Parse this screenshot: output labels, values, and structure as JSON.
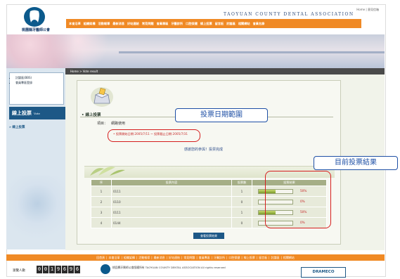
{
  "header": {
    "logo_text": "桃園縣牙醫師公會",
    "top_links": "Home | 意見信箱",
    "nav": [
      "本會沿革",
      "組織架構",
      "活動報導",
      "最新消息",
      "好站連結",
      "常見問題",
      "會員專區",
      "牙醫診所",
      "口腔保健",
      "線上投票",
      "留言板",
      "討論區",
      "相關網站",
      "會員名錄"
    ],
    "banner_text": "TAOYUAN COUNTY DENTAL ASSOCIATION"
  },
  "sidebar": {
    "links": [
      "討論區(BBS)",
      "會員專區登錄"
    ],
    "section_title": "線上投票",
    "section_title_en": "Vote",
    "sub_item": "線上投票"
  },
  "breadcrumb": "Home > Vote result",
  "vote": {
    "title": "線上投票",
    "item_label": "項目：",
    "item_value": "網路使用",
    "date_range": "投票開始日期:2005/7/11 ~ 投票截止日期:2005/7/31",
    "done_message": "感謝您的參與！投票完成",
    "result_button": "查看投票結果"
  },
  "results_table": {
    "headers": [
      "序",
      "投票內容",
      "投票數",
      "投票結果"
    ],
    "rows": [
      {
        "no": "1",
        "content": "0111",
        "votes": "1",
        "pct": 0.5,
        "pct_label": "50%"
      },
      {
        "no": "2",
        "content": "0110",
        "votes": "0",
        "pct": 0,
        "pct_label": "0%"
      },
      {
        "no": "3",
        "content": "0111",
        "votes": "1",
        "pct": 0.5,
        "pct_label": "50%"
      },
      {
        "no": "4",
        "content": "0144",
        "votes": "0",
        "pct": 0,
        "pct_label": "0%"
      }
    ]
  },
  "footer": {
    "nav": [
      "回首頁",
      "本會沿革",
      "組織架構",
      "活動報導",
      "最新消息",
      "好站連結",
      "常見問題",
      "會員專區",
      "牙醫診所",
      "口腔保健",
      "線上投票",
      "留言板",
      "討論區",
      "相關網站"
    ],
    "counter_label": "瀏覽人數",
    "counter_digits": [
      "0",
      "0",
      "1",
      "9",
      "6",
      "9",
      "6"
    ],
    "copyright": "桃園縣牙醫師公會版權所有 TAOYUAN COUNTY DENTAL ASSOCIATION All rights reserved",
    "badge": "DRAMECO"
  },
  "annotations": {
    "date_callout": "投票日期範圍",
    "result_callout": "目前投票結果"
  },
  "colors": {
    "nav_orange": "#f08a25",
    "header_blue": "#1d5886",
    "highlight_red": "#d61e1e",
    "callout_blue": "#1e4fa5"
  }
}
